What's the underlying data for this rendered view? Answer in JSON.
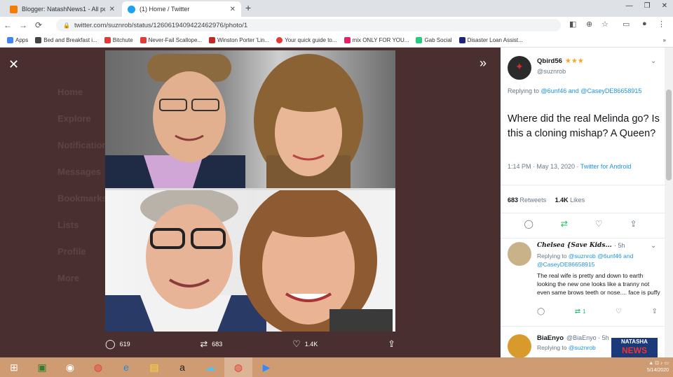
{
  "browser": {
    "tabs": [
      {
        "title": "Blogger: NatashNews1 - All po:",
        "active": false,
        "icon": "blogger-icon",
        "color": "#f57c00"
      },
      {
        "title": "(1) Home / Twitter",
        "active": true,
        "icon": "twitter-icon",
        "color": "#1da1f2"
      }
    ],
    "url": "twitter.com/suznrob/status/1260619409422462976/photo/1",
    "bookmarks": [
      {
        "label": "Apps",
        "color": "#4285f4"
      },
      {
        "label": "Bed and Breakfast i...",
        "color": "#444"
      },
      {
        "label": "Bitchute",
        "color": "#e53935"
      },
      {
        "label": "Never-Fail Scallope...",
        "color": "#e53935"
      },
      {
        "label": "Winston Porter 'Lin...",
        "color": "#c62828"
      },
      {
        "label": "Your quick guide to...",
        "color": "#e53935"
      },
      {
        "label": "mix ONLY FOR YOU...",
        "color": "#e91e63"
      },
      {
        "label": "Gab Social",
        "color": "#21cf7a"
      },
      {
        "label": "Disaster Loan Assist...",
        "color": "#1a237e"
      }
    ]
  },
  "viewer": {
    "ghost_nav": [
      "Home",
      "Explore",
      "Notifications",
      "Messages",
      "Bookmarks",
      "Lists",
      "Profile",
      "More"
    ],
    "photo_actions": {
      "replies": "619",
      "retweets": "683",
      "likes": "1.4K"
    }
  },
  "tweet": {
    "name": "Qbird56",
    "stars": "★★★",
    "handle": "@suznrob",
    "replying_prefix": "Replying to",
    "replying_to": "@6unf46 and @CaseyDE86658915",
    "text": "Where did the real Melinda go? Is this a cloning mishap? A Queen?",
    "time": "1:14 PM · May 13, 2020 ·",
    "via": "Twitter for Android",
    "retweets_count": "683",
    "retweets_label": "Retweets",
    "likes_count": "1.4K",
    "likes_label": "Likes"
  },
  "replies": [
    {
      "name": "Chelsea {Save Kids...",
      "time": "· 5h",
      "replying_prefix": "Replying to",
      "replying_to": "@suznrob @6unf46 and @CaseyDE86658915",
      "text": "The real wife is pretty and down to earth looking the new one looks like a tranny not even same brows teeth or nose.... face is puffy",
      "retweets": "1"
    },
    {
      "name": "BiaEnyo",
      "handle": "@BiaEnyo · 5h",
      "replying_prefix": "Replying to",
      "replying_to": "@suznrob"
    }
  ],
  "taskbar": {
    "date": "5/14/2020"
  },
  "watermark": {
    "line1": "NATASHA",
    "line2": "NEWS"
  }
}
